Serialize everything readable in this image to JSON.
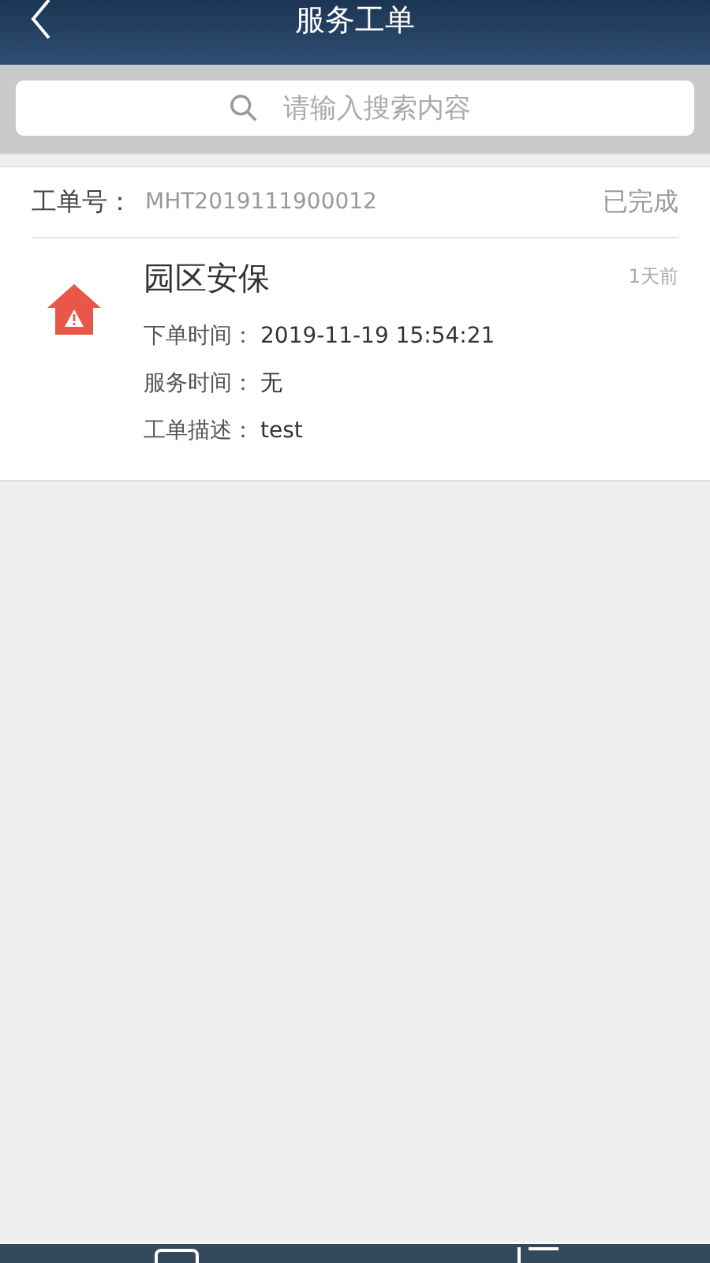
{
  "header": {
    "title": "服务工单"
  },
  "search": {
    "placeholder": "请输入搜索内容"
  },
  "orders": [
    {
      "number_label": "工单号：",
      "number": "MHT2019111900012",
      "status": "已完成",
      "title": "园区安保",
      "age": "1天前",
      "fields": [
        {
          "label": "下单时间：",
          "value": "2019-11-19 15:54:21"
        },
        {
          "label": "服务时间：",
          "value": "无"
        },
        {
          "label": "工单描述：",
          "value": "test"
        }
      ]
    }
  ]
}
